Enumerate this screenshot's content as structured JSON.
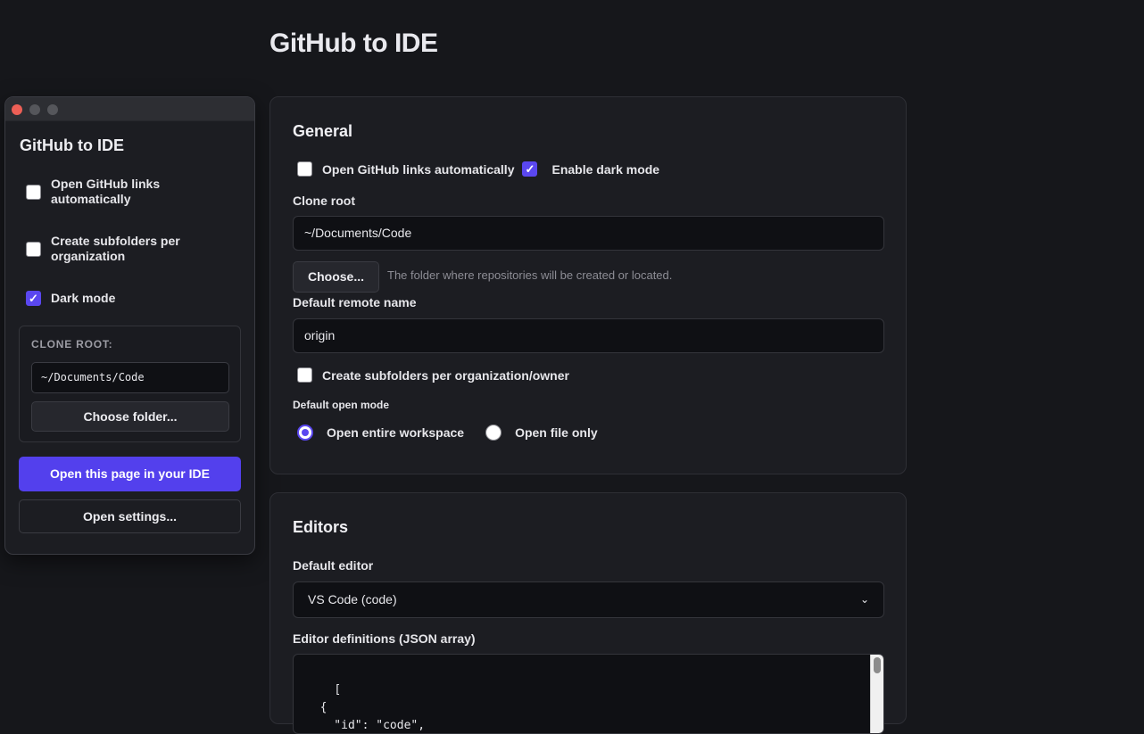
{
  "page": {
    "title": "GitHub to IDE"
  },
  "popup": {
    "title": "GitHub to IDE",
    "options": [
      {
        "label": "Open GitHub links automatically",
        "checked": false
      },
      {
        "label": "Create subfolders per organization",
        "checked": false
      },
      {
        "label": "Dark mode",
        "checked": true
      }
    ],
    "clone_root": {
      "label": "CLONE ROOT:",
      "value": "~/Documents/Code",
      "choose_label": "Choose folder..."
    },
    "open_ide_label": "Open this page in your IDE",
    "open_settings_label": "Open settings..."
  },
  "general": {
    "title": "General",
    "open_links_label": "Open GitHub links automatically",
    "open_links_checked": false,
    "dark_mode_label": "Enable dark mode",
    "dark_mode_checked": true,
    "clone_root_label": "Clone root",
    "clone_root_value": "~/Documents/Code",
    "choose_label": "Choose...",
    "clone_root_hint": "The folder where repositories will be created or located.",
    "remote_label": "Default remote name",
    "remote_value": "origin",
    "subfolders_label": "Create subfolders per organization/owner",
    "subfolders_checked": false,
    "open_mode_label": "Default open mode",
    "open_mode_options": [
      {
        "label": "Open entire workspace",
        "selected": true
      },
      {
        "label": "Open file only",
        "selected": false
      }
    ]
  },
  "editors": {
    "title": "Editors",
    "default_editor_label": "Default editor",
    "default_editor_value": "VS Code (code)",
    "definitions_label": "Editor definitions (JSON array)",
    "definitions_text": "[\n  {\n    \"id\": \"code\","
  },
  "colors": {
    "accent": "#5340ed",
    "background": "#16171b",
    "card": "#1c1d22"
  }
}
